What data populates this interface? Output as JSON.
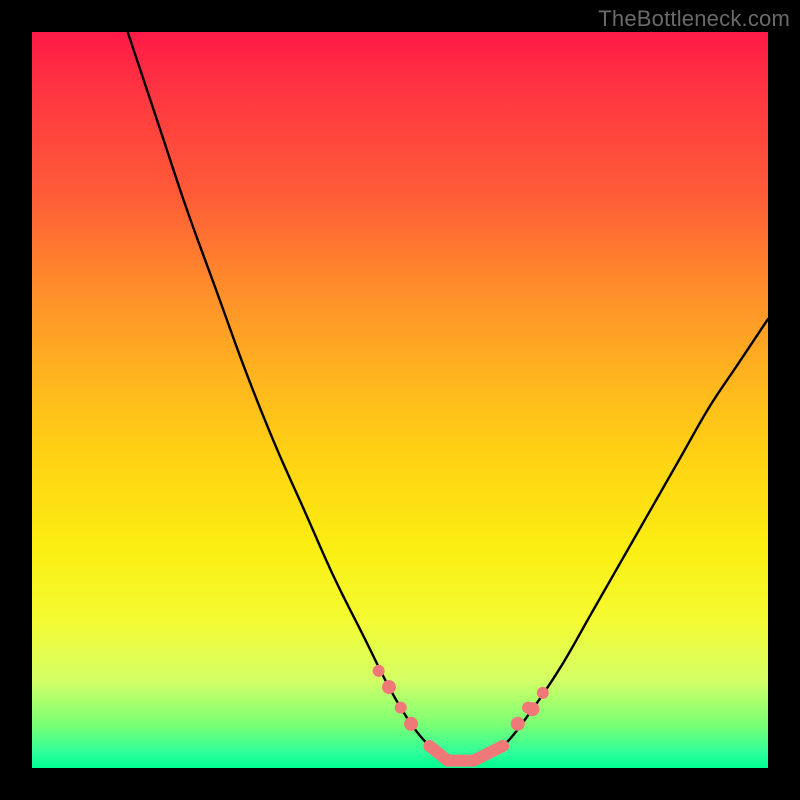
{
  "watermark": "TheBottleneck.com",
  "colors": {
    "frame": "#000000",
    "curve": "#000000",
    "marker": "#f07878",
    "gradient_top": "#ff1a48",
    "gradient_bottom": "#00ff8f"
  },
  "chart_data": {
    "type": "line",
    "title": "",
    "xlabel": "",
    "ylabel": "",
    "xlim": [
      0,
      100
    ],
    "ylim": [
      0,
      100
    ],
    "x": [
      13,
      17,
      21,
      25,
      29,
      33,
      37,
      41,
      45,
      48.5,
      51.5,
      54,
      56.5,
      60,
      64,
      68,
      72,
      76,
      80,
      84,
      88,
      92,
      96,
      100
    ],
    "values": [
      100,
      88,
      76,
      65,
      54,
      44,
      35,
      26,
      18,
      11,
      6,
      3,
      1,
      1,
      3,
      8,
      14,
      21,
      28,
      35,
      42,
      49,
      55,
      61
    ],
    "markers": {
      "x": [
        48.5,
        51.5,
        54,
        56.5,
        60,
        64,
        66,
        68
      ],
      "y": [
        11,
        6,
        3,
        1,
        1,
        3,
        6,
        8
      ]
    }
  }
}
